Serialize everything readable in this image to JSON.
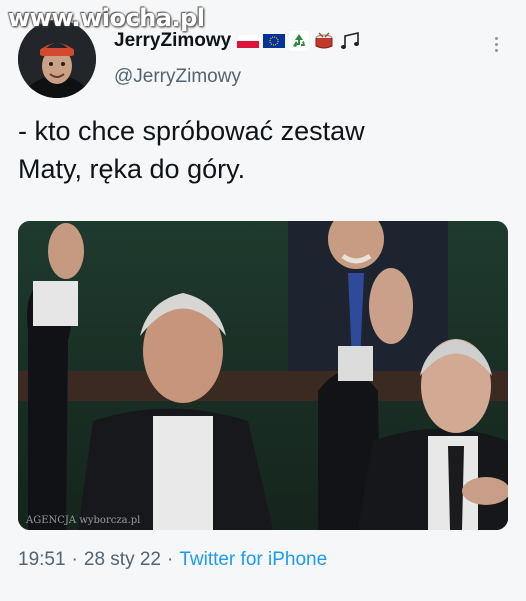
{
  "watermark": "www.wiocha.pl",
  "author": {
    "display_name": "JerryZimowy",
    "handle": "@JerryZimowy",
    "emoji_icons": [
      "poland-flag-icon",
      "eu-flag-icon",
      "recycle-icon",
      "drum-icon",
      "music-notes-icon"
    ]
  },
  "tweet": {
    "text": "- kto chce spróbować zestaw\nMaty, ręka do góry."
  },
  "photo": {
    "credit": "AGENCJA wyborcza.pl"
  },
  "meta": {
    "time": "19:51",
    "separator": "·",
    "date": "28 sty 22",
    "source": "Twitter for iPhone"
  },
  "colors": {
    "text": "#0f1419",
    "secondary": "#536471",
    "link": "#1d9bf0",
    "background": "#f6f7f8"
  }
}
